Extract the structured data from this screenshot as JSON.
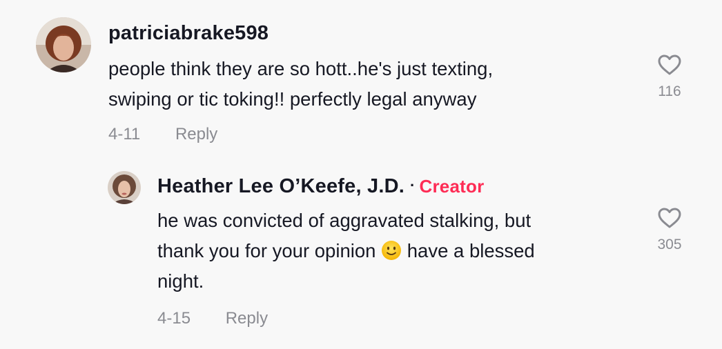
{
  "comments": [
    {
      "username": "patriciabrake598",
      "text_lines": [
        "people think they are so hott..he's just texting,",
        "swiping or tic toking!! perfectly legal anyway"
      ],
      "date": "4-11",
      "reply_label": "Reply",
      "like_count": "116",
      "avatar_icon": "avatar-photo"
    }
  ],
  "reply": {
    "username": "Heather Lee O’Keefe, J.D.",
    "separator": "·",
    "badge": "Creator",
    "text_lines": [
      "he was convicted of aggravated stalking, but",
      "thank you for your opinion",
      " have a blessed",
      "night."
    ],
    "emoji_icon": "slightly-smiling-face-emoji",
    "date": "4-15",
    "reply_label": "Reply",
    "like_count": "305",
    "avatar_icon": "avatar-photo"
  },
  "colors": {
    "background": "#f8f8f8",
    "text": "#161823",
    "muted": "#8a8b91",
    "creator_badge": "#fe2c55"
  }
}
